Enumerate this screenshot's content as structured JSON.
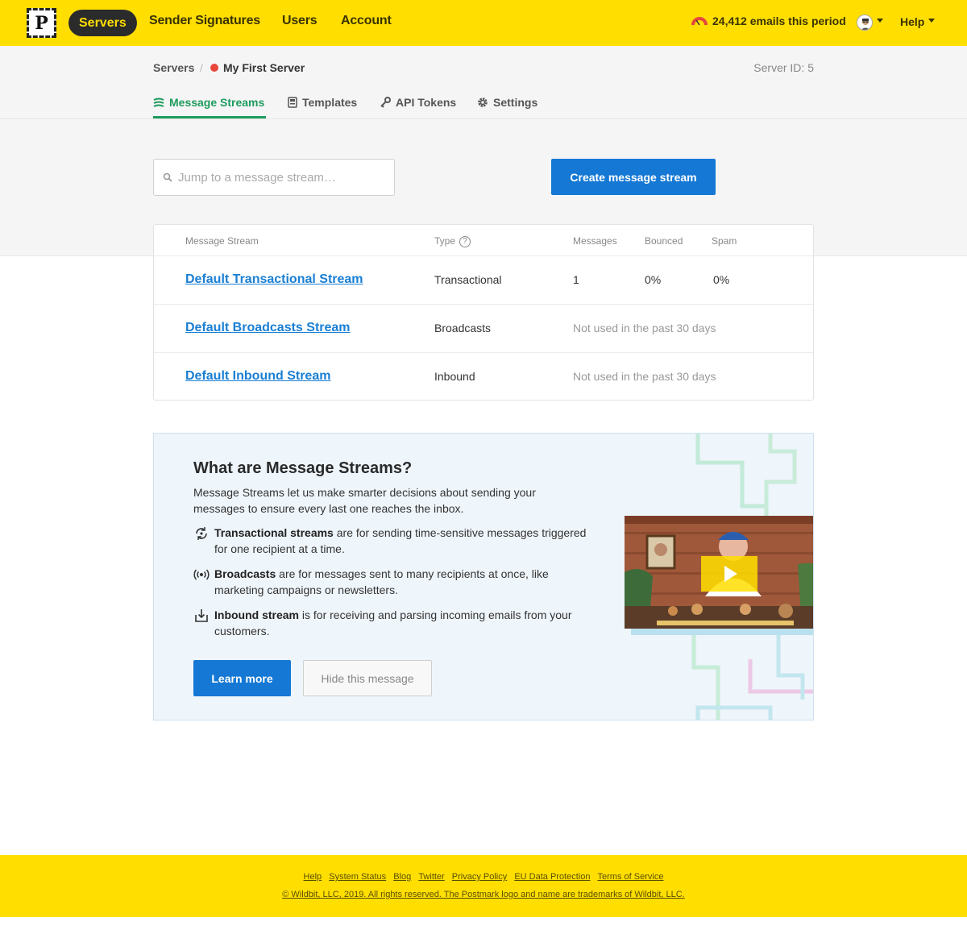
{
  "nav": {
    "logo_letter": "P",
    "items": [
      {
        "label": "Servers"
      },
      {
        "label": "Sender Signatures"
      },
      {
        "label": "Users"
      },
      {
        "label": "Account"
      }
    ],
    "usage": "24,412 emails this period",
    "help": "Help"
  },
  "breadcrumb": {
    "root": "Servers",
    "separator": "/",
    "current": "My First Server",
    "server_id": "Server ID: 5"
  },
  "tabs": [
    {
      "label": "Message Streams",
      "icon": "streams-icon"
    },
    {
      "label": "Templates",
      "icon": "templates-icon"
    },
    {
      "label": "API Tokens",
      "icon": "key-icon"
    },
    {
      "label": "Settings",
      "icon": "gear-icon"
    }
  ],
  "search": {
    "placeholder": "Jump to a message stream…"
  },
  "create_button": "Create message stream",
  "table": {
    "headers": {
      "stream": "Message Stream",
      "type": "Type",
      "help": "?",
      "messages": "Messages",
      "bounced": "Bounced",
      "spam": "Spam"
    },
    "rows": [
      {
        "name": "Default Transactional Stream",
        "type": "Transactional",
        "messages": "1",
        "bounced": "0%",
        "spam": "0%"
      },
      {
        "name": "Default Broadcasts Stream",
        "type": "Broadcasts",
        "note": "Not used in the past 30 days"
      },
      {
        "name": "Default Inbound Stream",
        "type": "Inbound",
        "note": "Not used in the past 30 days"
      }
    ]
  },
  "info": {
    "title": "What are Message Streams?",
    "intro": "Message Streams let us make smarter decisions about sending your messages to ensure every last one reaches the inbox.",
    "bullets": [
      {
        "bold": "Transactional streams",
        "text": " are for sending time-sensitive messages triggered for one recipient at a time."
      },
      {
        "bold": "Broadcasts",
        "text": " are for messages sent to many recipients at once, like marketing campaigns or newsletters."
      },
      {
        "bold": "Inbound stream",
        "text": " is for receiving and parsing incoming emails from your customers."
      }
    ],
    "learn_more": "Learn more",
    "hide": "Hide this message"
  },
  "footer": {
    "links": [
      "Help",
      "System Status",
      "Blog",
      "Twitter",
      "Privacy Policy",
      "EU Data Protection",
      "Terms of Service"
    ],
    "copyright": "© Wildbit, LLC, 2019. All rights reserved. The Postmark logo and name are trademarks of Wildbit, LLC."
  },
  "colors": {
    "brand_yellow": "#ffde00",
    "accent_blue": "#1478d4",
    "active_green": "#1e9b5e",
    "status_red": "#e8453c"
  }
}
